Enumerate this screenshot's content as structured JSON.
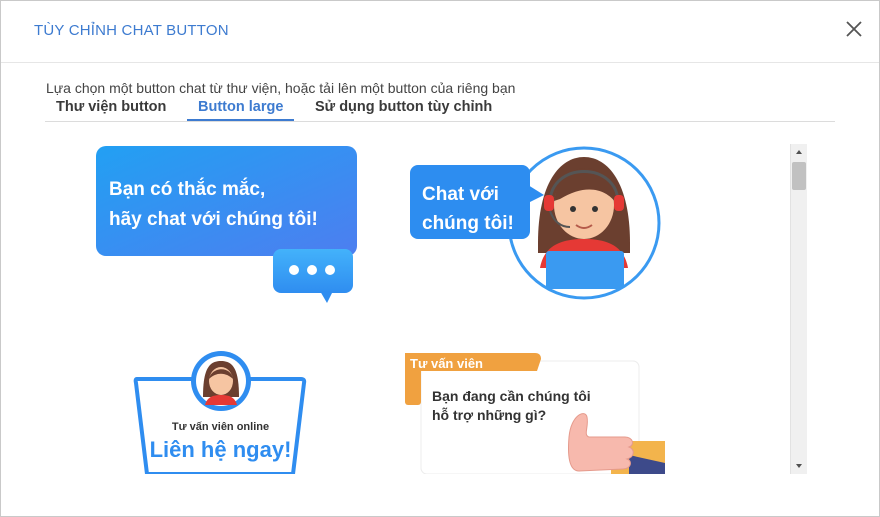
{
  "dialog": {
    "title": "TÙY CHỈNH CHAT BUTTON",
    "description": "Lựa chọn một button chat từ thư viện, hoặc tải lên một button của riêng bạn"
  },
  "tabs": [
    {
      "label": "Thư viện button",
      "active": false
    },
    {
      "label": "Button large",
      "active": true
    },
    {
      "label": "Sử dụng button tùy chỉnh",
      "active": false
    }
  ],
  "buttons": {
    "b1": {
      "line1": "Bạn có thắc mắc,",
      "line2": "hãy chat với chúng tôi!"
    },
    "b2": {
      "line1": "Chat với",
      "line2": "chúng tôi!"
    },
    "b3": {
      "subtitle": "Tư vấn viên online",
      "title": "Liên hệ ngay!"
    },
    "b4": {
      "tag": "Tư vấn viên",
      "line1": "Bạn đang cần chúng tôi",
      "line2": "hỗ trợ những gì?"
    }
  },
  "icons": {
    "close": "close-icon",
    "scroll_up": "arrow-up-icon",
    "scroll_down": "arrow-down-icon"
  },
  "colors": {
    "accent": "#3d7bd0",
    "bubble_blue_start": "#2196f3",
    "bubble_blue_end": "#4e7ff0",
    "tag_orange": "#f5a623"
  }
}
